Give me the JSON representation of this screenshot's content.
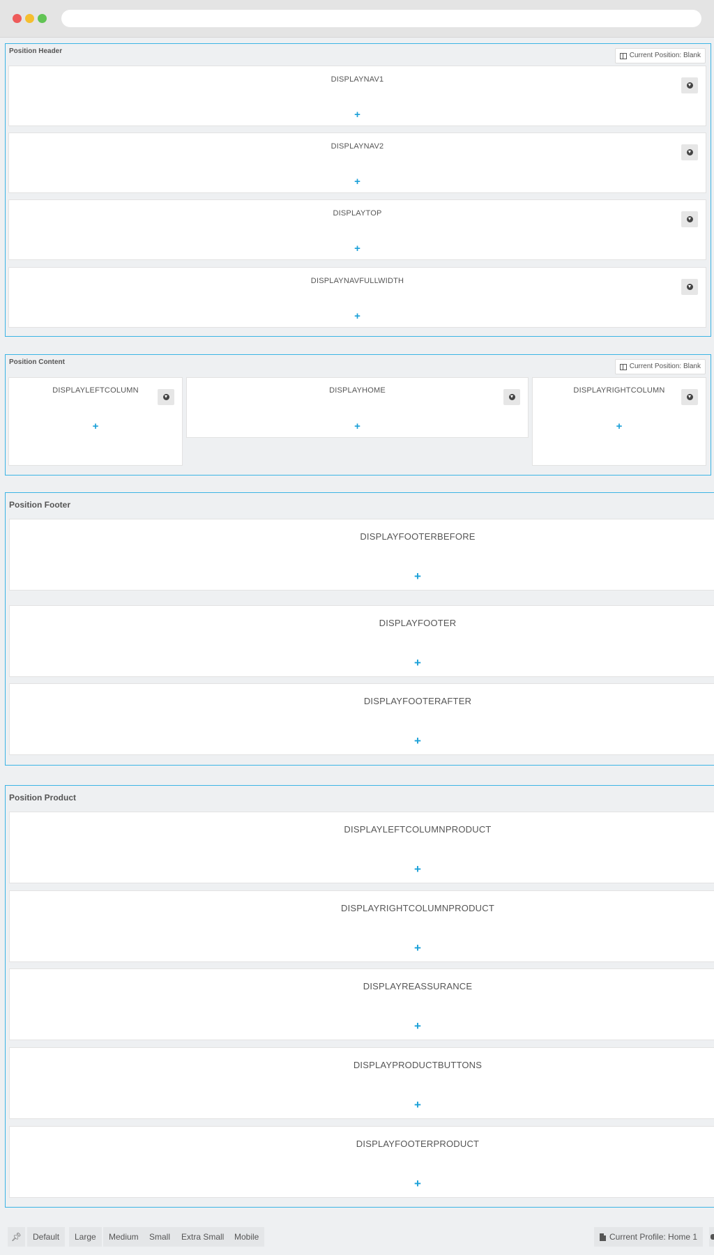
{
  "positions": {
    "header": {
      "title": "Position Header",
      "current_position": "Current Position: Blank",
      "hooks": [
        {
          "name": "DISPLAYNAV1",
          "add": "+"
        },
        {
          "name": "DISPLAYNAV2",
          "add": "+"
        },
        {
          "name": "DISPLAYTOP",
          "add": "+"
        },
        {
          "name": "DISPLAYNAVFULLWIDTH",
          "add": "+"
        }
      ]
    },
    "content": {
      "title": "Position Content",
      "current_position": "Current Position: Blank",
      "hooks": [
        {
          "name": "DISPLAYLEFTCOLUMN",
          "add": "+"
        },
        {
          "name": "DISPLAYHOME",
          "add": "+"
        },
        {
          "name": "DISPLAYRIGHTCOLUMN",
          "add": "+"
        }
      ]
    },
    "footer": {
      "title": "Position Footer",
      "hooks": [
        {
          "name": "DISPLAYFOOTERBEFORE",
          "add": "+"
        },
        {
          "name": "DISPLAYFOOTER",
          "add": "+"
        },
        {
          "name": "DISPLAYFOOTERAFTER",
          "add": "+"
        }
      ]
    },
    "product": {
      "title": "Position Product",
      "hooks": [
        {
          "name": "DISPLAYLEFTCOLUMNPRODUCT",
          "add": "+"
        },
        {
          "name": "DISPLAYRIGHTCOLUMNPRODUCT",
          "add": "+"
        },
        {
          "name": "DISPLAYREASSURANCE",
          "add": "+"
        },
        {
          "name": "DISPLAYPRODUCTBUTTONS",
          "add": "+"
        },
        {
          "name": "DISPLAYFOOTERPRODUCT",
          "add": "+"
        }
      ]
    }
  },
  "toolbar": {
    "pin_icon": "pin-icon",
    "devices": [
      "Default",
      "Large",
      "Medium",
      "Small",
      "Extra Small",
      "Mobile"
    ],
    "current_profile": "Current Profile: Home 1"
  }
}
